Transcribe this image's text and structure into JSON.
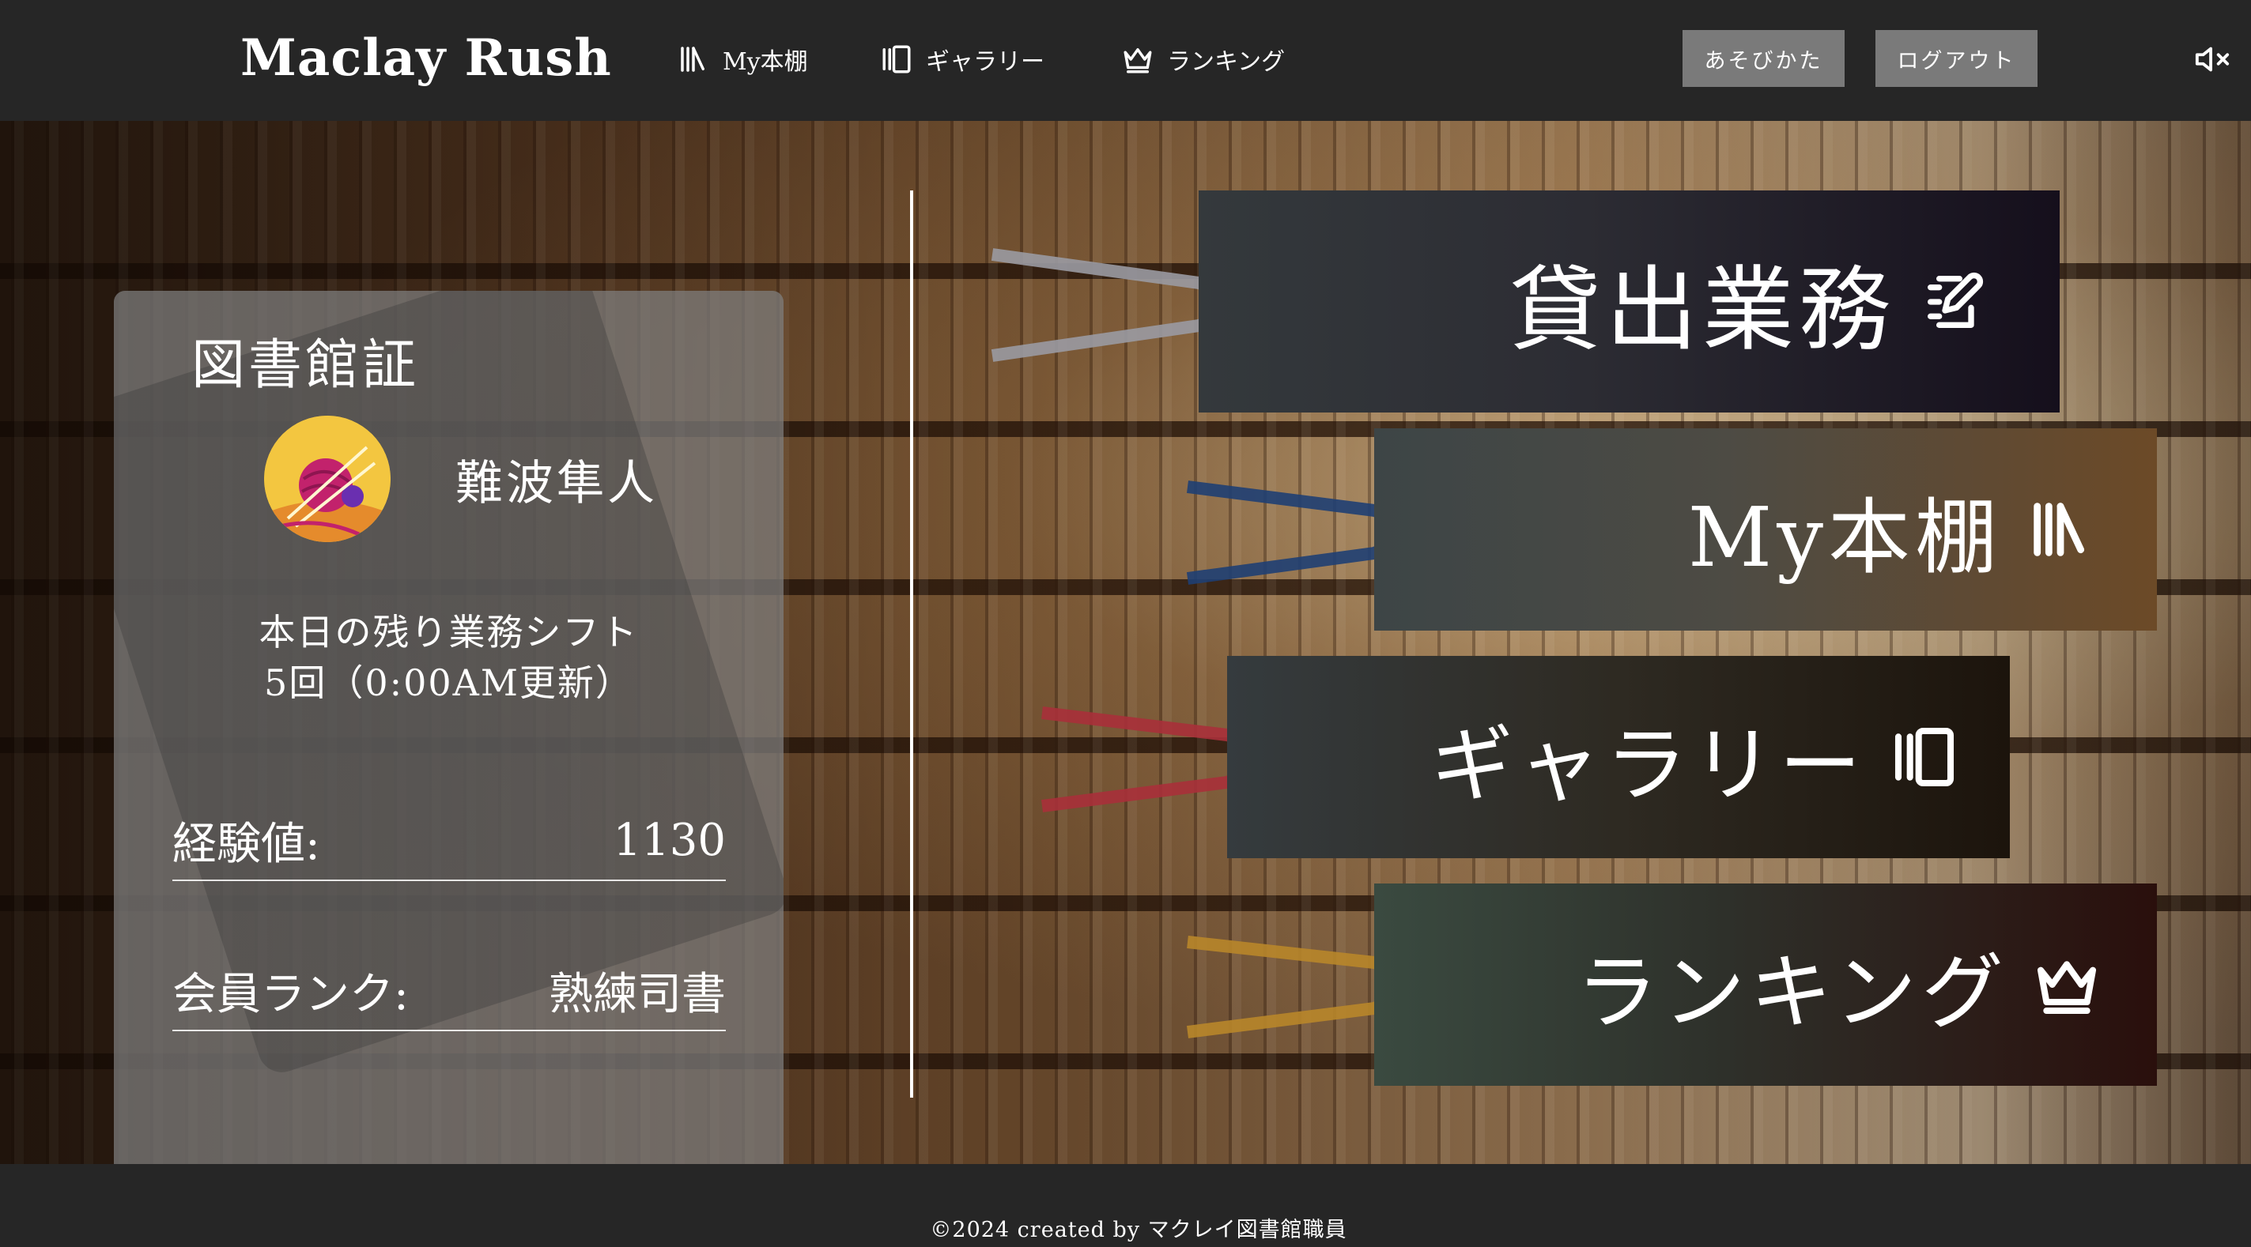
{
  "header": {
    "logo": "Maclay Rush",
    "nav": [
      {
        "label": "My本棚",
        "icon": "bookshelf-icon"
      },
      {
        "label": "ギャラリー",
        "icon": "gallery-icon"
      },
      {
        "label": "ランキング",
        "icon": "crown-icon"
      }
    ],
    "howto_label": "あそびかた",
    "logout_label": "ログアウト",
    "mute_icon": "volume-mute-icon"
  },
  "card": {
    "title": "図書館証",
    "username": "難波隼人",
    "shift_line1": "本日の残り業務シフト",
    "shift_line2": "5回（0:00AM更新）",
    "exp_label": "経験値:",
    "exp_value": "1130",
    "rank_label": "会員ランク:",
    "rank_value": "熟練司書"
  },
  "menu": [
    {
      "label": "貸出業務",
      "icon": "edit-icon",
      "string_color": "#9a9aa2"
    },
    {
      "label": "My本棚",
      "icon": "bookshelf-icon",
      "string_color": "#1f3f73"
    },
    {
      "label": "ギャラリー",
      "icon": "gallery-icon",
      "string_color": "#a8303a"
    },
    {
      "label": "ランキング",
      "icon": "crown-icon",
      "string_color": "#b8862a"
    }
  ],
  "footer": {
    "text": "©2024 created by マクレイ図書館職員"
  }
}
